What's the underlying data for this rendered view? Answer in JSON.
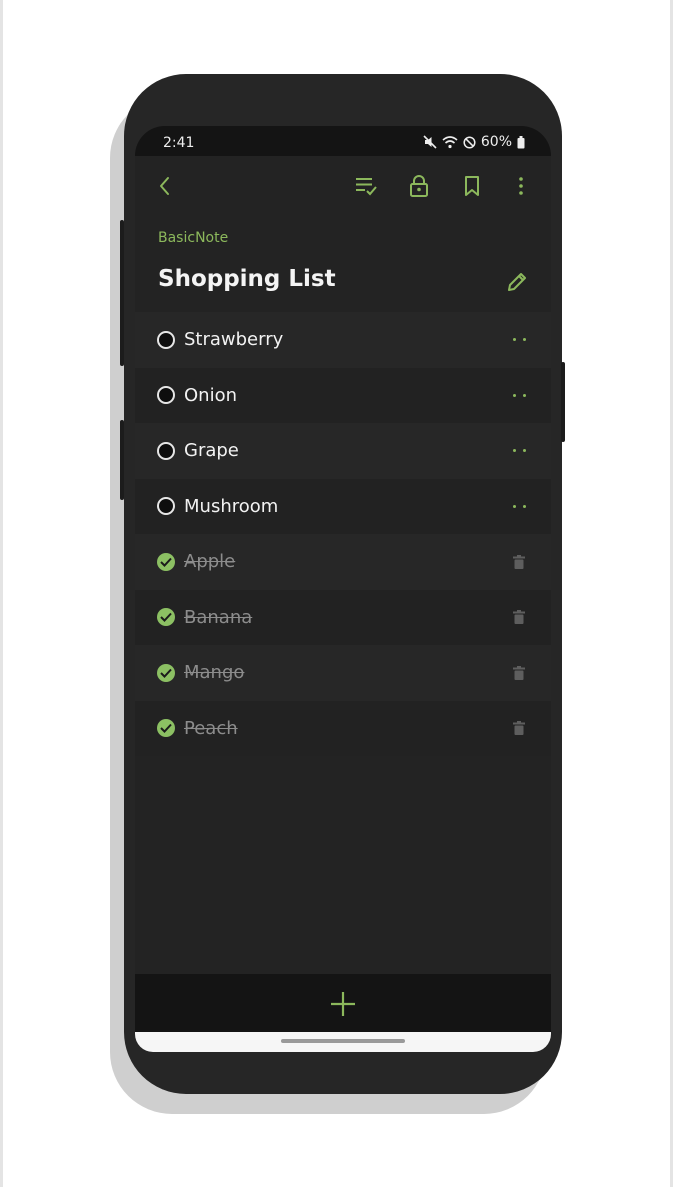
{
  "status_bar": {
    "time": "2:41",
    "battery": "60%",
    "icons": [
      "mute-icon",
      "wifi-icon",
      "dnd-icon",
      "battery-icon"
    ]
  },
  "toolbar": {
    "icons": [
      "back-icon",
      "checklist-sort-icon",
      "lock-icon",
      "bookmark-icon",
      "more-vert-icon"
    ]
  },
  "note": {
    "app_name": "BasicNote",
    "title": "Shopping List"
  },
  "items": [
    {
      "label": "Strawberry",
      "checked": false
    },
    {
      "label": "Onion",
      "checked": false
    },
    {
      "label": "Grape",
      "checked": false
    },
    {
      "label": "Mushroom",
      "checked": false
    },
    {
      "label": "Apple",
      "checked": true
    },
    {
      "label": "Banana",
      "checked": true
    },
    {
      "label": "Mango",
      "checked": true
    },
    {
      "label": "Peach",
      "checked": true
    }
  ],
  "colors": {
    "accent": "#8cb85c",
    "checked": "#8cc063",
    "background": "#232323",
    "bottom_bar": "#141414"
  }
}
